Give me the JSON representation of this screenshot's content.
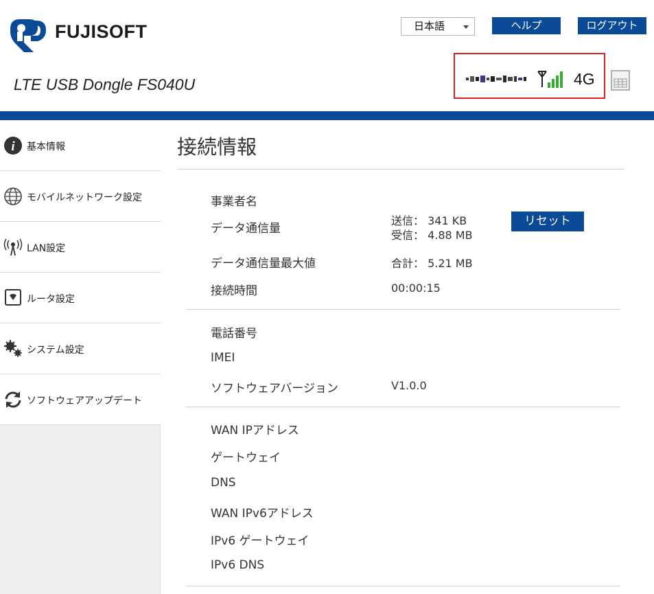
{
  "header": {
    "brand": "FUJISOFT",
    "product": "LTE USB Dongle FS040U",
    "language": "日本語",
    "help_label": "ヘルプ",
    "logout_label": "ログアウト"
  },
  "status": {
    "signal_level": "4/4",
    "network_type": "4G",
    "signal_color": "#3aaa35"
  },
  "sidebar": {
    "items": [
      {
        "label": "基本情報",
        "icon": "info-icon"
      },
      {
        "label": "モバイルネットワーク設定",
        "icon": "globe-icon"
      },
      {
        "label": "LAN設定",
        "icon": "wireless-antenna-icon"
      },
      {
        "label": "ルータ設定",
        "icon": "router-icon"
      },
      {
        "label": "システム設定",
        "icon": "gears-icon"
      },
      {
        "label": "ソフトウェアアップデート",
        "icon": "refresh-icon"
      }
    ]
  },
  "main": {
    "title": "接続情報",
    "connection": {
      "operator_label": "事業者名",
      "usage_label": "データ通信量",
      "sent": "送信： 341 KB",
      "received": "受信： 4.88 MB",
      "reset_label": "リセット",
      "max_usage_label": "データ通信量最大値",
      "total": "合計： 5.21 MB",
      "time_label": "接続時間",
      "time_value": "00:00:15"
    },
    "device": {
      "phone_label": "電話番号",
      "imei_label": "IMEI",
      "version_label": "ソフトウェアバージョン",
      "version_value": "V1.0.0"
    },
    "wan": {
      "wan_ip_label": "WAN IPアドレス",
      "gateway_label": "ゲートウェイ",
      "dns_label": "DNS",
      "wan_ipv6_label": "WAN IPv6アドレス",
      "ipv6_gateway_label": "IPv6 ゲートウェイ",
      "ipv6_dns_label": "IPv6 DNS"
    }
  },
  "colors": {
    "brand_blue": "#0a4a96",
    "status_border": "#e02020"
  }
}
